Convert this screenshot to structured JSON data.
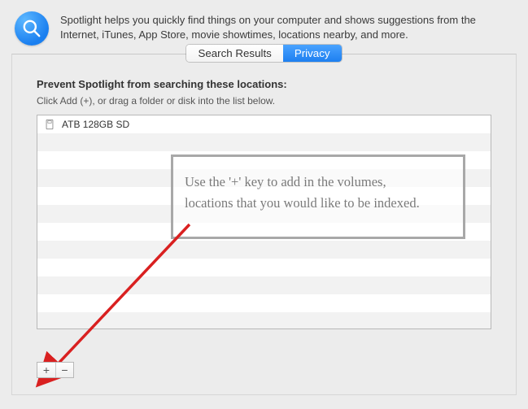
{
  "header": {
    "description": "Spotlight helps you quickly find things on your computer and shows suggestions from the Internet, iTunes, App Store, movie showtimes, locations nearby, and more."
  },
  "tabs": {
    "search_results": "Search Results",
    "privacy": "Privacy"
  },
  "privacy": {
    "title": "Prevent Spotlight from searching these locations:",
    "subtitle": "Click Add (+), or drag a folder or disk into the list below.",
    "items": [
      {
        "label": "ATB 128GB SD"
      }
    ]
  },
  "buttons": {
    "add": "+",
    "remove": "−"
  },
  "annotation": {
    "line1": "Use the '+' key to add in the volumes,",
    "line2": "locations that you would like to be indexed."
  }
}
